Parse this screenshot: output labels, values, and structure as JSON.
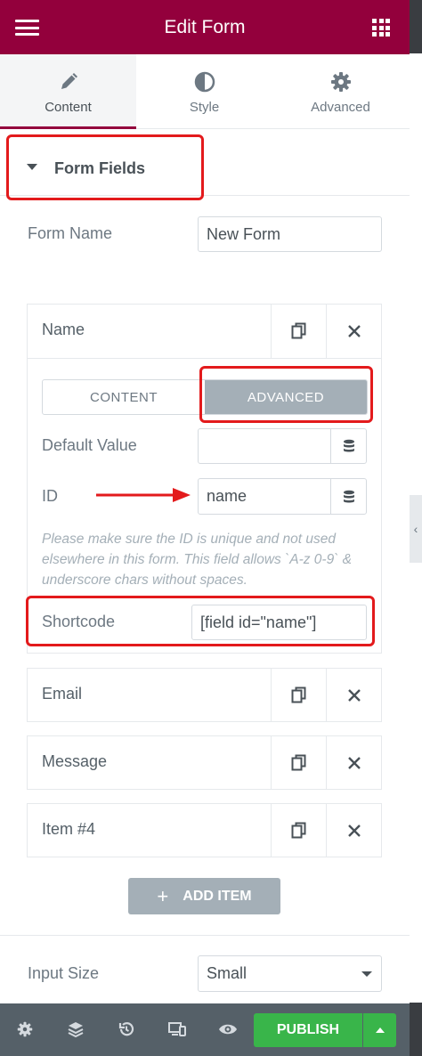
{
  "header": {
    "title": "Edit Form"
  },
  "tabs": [
    {
      "label": "Content",
      "icon": "pencil-icon",
      "active": true
    },
    {
      "label": "Style",
      "icon": "half-circle-icon",
      "active": false
    },
    {
      "label": "Advanced",
      "icon": "gear-icon",
      "active": false
    }
  ],
  "section": {
    "title": "Form Fields"
  },
  "form_name": {
    "label": "Form Name",
    "value": "New Form"
  },
  "fields": [
    {
      "title": "Name",
      "expanded": true,
      "tabs": {
        "content": "CONTENT",
        "advanced": "ADVANCED",
        "selected": "ADVANCED"
      },
      "default_value": {
        "label": "Default Value",
        "value": ""
      },
      "id": {
        "label": "ID",
        "value": "name"
      },
      "note": "Please make sure the ID is unique and not used elsewhere in this form. This field allows `A-z 0-9` & underscore chars without spaces.",
      "shortcode": {
        "label": "Shortcode",
        "value": "[field id=\"name\"]"
      }
    },
    {
      "title": "Email",
      "expanded": false
    },
    {
      "title": "Message",
      "expanded": false
    },
    {
      "title": "Item #4",
      "expanded": false
    }
  ],
  "add_item": {
    "label": "ADD ITEM"
  },
  "input_size": {
    "label": "Input Size",
    "value": "Small"
  },
  "footer": {
    "publish_label": "PUBLISH",
    "icons": [
      "settings-icon",
      "layers-icon",
      "history-icon",
      "responsive-icon",
      "preview-icon"
    ]
  },
  "colors": {
    "header_bg": "#93003c",
    "annotation_red": "#e31a1c",
    "publish_green": "#39b54a",
    "footer_bg": "#556068",
    "selected_segment": "#a4afb7"
  }
}
